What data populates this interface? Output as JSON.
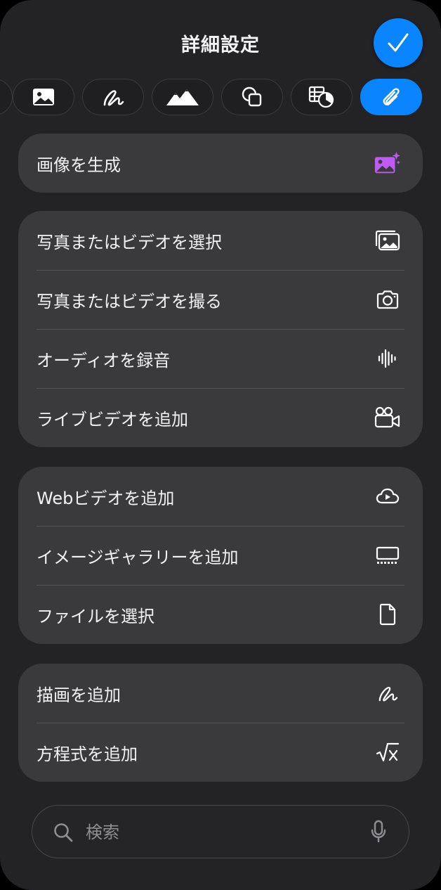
{
  "header": {
    "title": "詳細設定",
    "done_icon": "checkmark-icon"
  },
  "tabs": [
    {
      "icon": "partial-icon"
    },
    {
      "icon": "photo-icon"
    },
    {
      "icon": "scribble-icon"
    },
    {
      "icon": "mountains-icon"
    },
    {
      "icon": "shapes-icon"
    },
    {
      "icon": "table-chart-icon"
    },
    {
      "icon": "paperclip-icon",
      "active": true
    }
  ],
  "groups": [
    {
      "items": [
        {
          "label": "画像を生成",
          "icon": "image-sparkle-icon"
        }
      ]
    },
    {
      "items": [
        {
          "label": "写真またはビデオを選択",
          "icon": "photo-library-icon"
        },
        {
          "label": "写真またはビデオを撮る",
          "icon": "camera-icon"
        },
        {
          "label": "オーディオを録音",
          "icon": "waveform-icon"
        },
        {
          "label": "ライブビデオを追加",
          "icon": "video-camera-icon"
        }
      ]
    },
    {
      "items": [
        {
          "label": "Webビデオを追加",
          "icon": "cloud-play-icon"
        },
        {
          "label": "イメージギャラリーを追加",
          "icon": "gallery-icon"
        },
        {
          "label": "ファイルを選択",
          "icon": "document-icon"
        }
      ]
    },
    {
      "items": [
        {
          "label": "描画を追加",
          "icon": "scribble-icon"
        },
        {
          "label": "方程式を追加",
          "icon": "square-root-icon"
        }
      ]
    }
  ],
  "search": {
    "placeholder": "検索",
    "value": ""
  },
  "colors": {
    "accent": "#0a84ff",
    "panel": "#232325",
    "group": "#3a3a3c",
    "purple": "#bf5af2"
  }
}
